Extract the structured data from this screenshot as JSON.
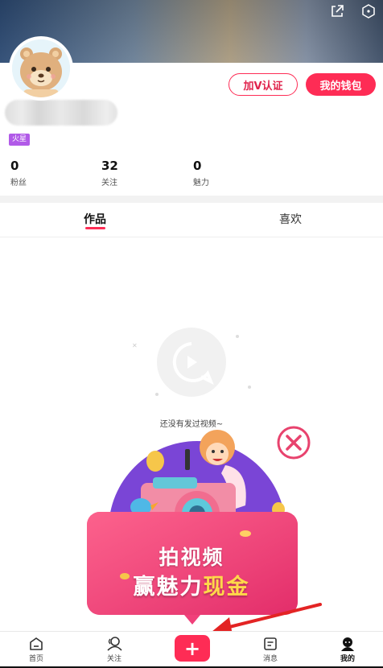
{
  "profile": {
    "level_badge": "火星",
    "verify_button": "加V认证",
    "wallet_button": "我的钱包"
  },
  "stats": [
    {
      "value": "0",
      "label": "粉丝"
    },
    {
      "value": "32",
      "label": "关注"
    },
    {
      "value": "0",
      "label": "魅力"
    }
  ],
  "tabs": {
    "works": "作品",
    "likes": "喜欢"
  },
  "empty_state": {
    "text": "还没有发过视频~"
  },
  "promo": {
    "line1": "拍视频",
    "line2_white": "赢魅力",
    "line2_yellow": "现金"
  },
  "bottom_nav": {
    "home": "首页",
    "follow": "关注",
    "create": "+",
    "messages": "消息",
    "me": "我的"
  },
  "colors": {
    "accent": "#fe2c55",
    "badge": "#b15ae8",
    "promo_pink": "#f0407a",
    "promo_yellow": "#ffd84a"
  }
}
